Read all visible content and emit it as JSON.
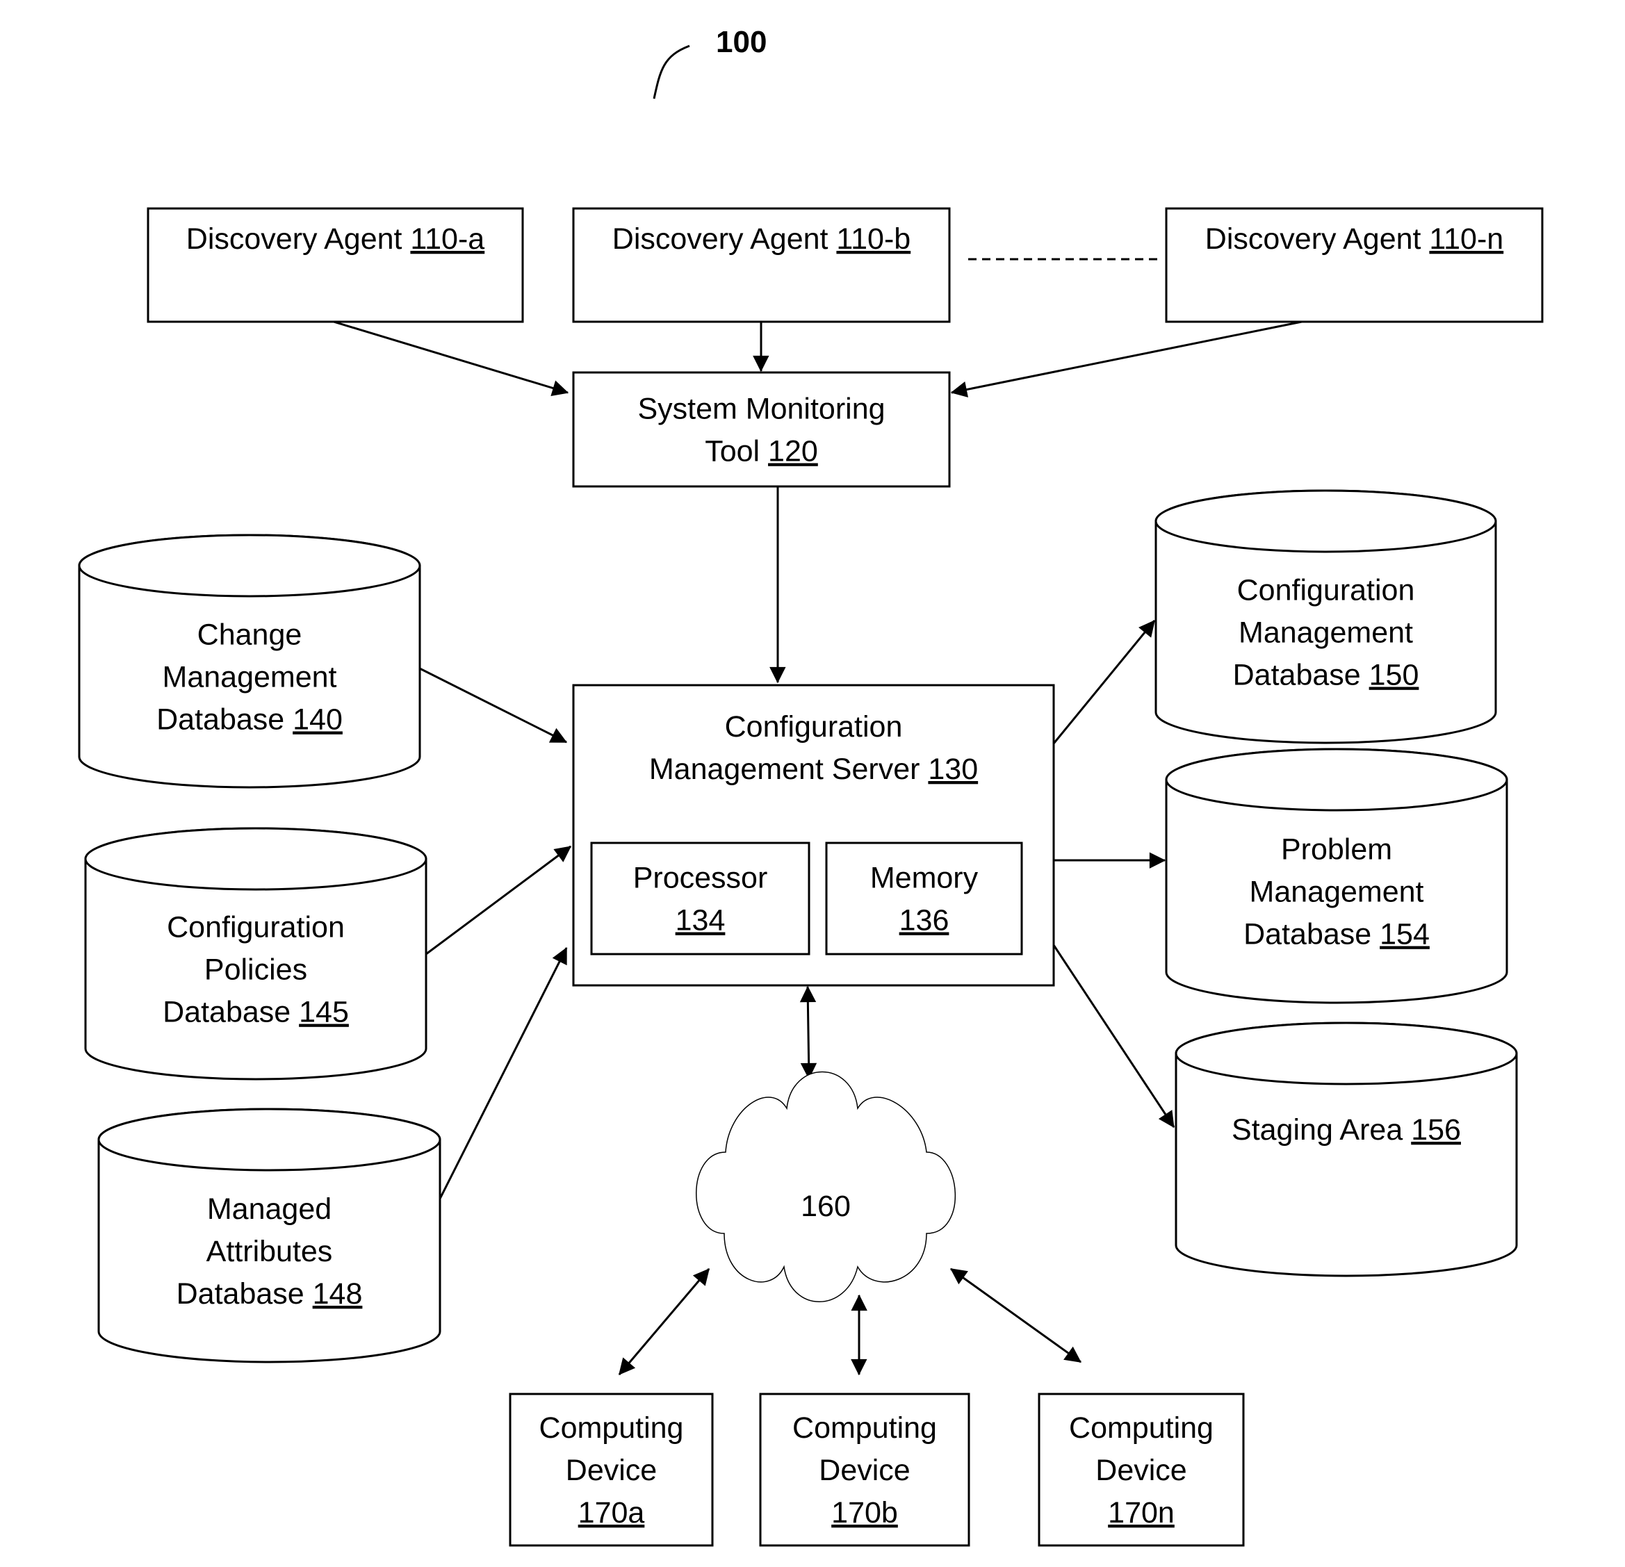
{
  "figure": {
    "reference_number": "100",
    "accent_color": "#000000",
    "background_color": "#ffffff"
  },
  "nodes": {
    "agent_a": {
      "lines": [
        {
          "text": "Discovery Agent ",
          "ref": "110-a"
        }
      ]
    },
    "agent_b": {
      "lines": [
        {
          "text": "Discovery Agent ",
          "ref": "110-b"
        }
      ]
    },
    "agent_n": {
      "lines": [
        {
          "text": "Discovery Agent ",
          "ref": "110-n"
        }
      ]
    },
    "monitoring_tool": {
      "lines": [
        {
          "text": "System Monitoring",
          "ref": ""
        },
        {
          "text": "Tool ",
          "ref": "120"
        }
      ]
    },
    "server": {
      "lines": [
        {
          "text": "Configuration",
          "ref": ""
        },
        {
          "text": "Management Server ",
          "ref": "130"
        }
      ]
    },
    "processor": {
      "lines": [
        {
          "text": "Processor",
          "ref": ""
        },
        {
          "text": "",
          "ref": "134"
        }
      ]
    },
    "memory": {
      "lines": [
        {
          "text": "Memory",
          "ref": ""
        },
        {
          "text": "",
          "ref": "136"
        }
      ]
    },
    "db_140": {
      "lines": [
        {
          "text": "Change",
          "ref": ""
        },
        {
          "text": "Management",
          "ref": ""
        },
        {
          "text": "Database ",
          "ref": "140"
        }
      ]
    },
    "db_145": {
      "lines": [
        {
          "text": "Configuration",
          "ref": ""
        },
        {
          "text": "Policies",
          "ref": ""
        },
        {
          "text": "Database ",
          "ref": "145"
        }
      ]
    },
    "db_148": {
      "lines": [
        {
          "text": "Managed",
          "ref": ""
        },
        {
          "text": "Attributes",
          "ref": ""
        },
        {
          "text": "Database ",
          "ref": "148"
        }
      ]
    },
    "db_150": {
      "lines": [
        {
          "text": "Configuration",
          "ref": ""
        },
        {
          "text": "Management",
          "ref": ""
        },
        {
          "text": "Database ",
          "ref": "150"
        }
      ]
    },
    "db_154": {
      "lines": [
        {
          "text": "Problem",
          "ref": ""
        },
        {
          "text": "Management",
          "ref": ""
        },
        {
          "text": "Database ",
          "ref": "154"
        }
      ]
    },
    "db_156": {
      "lines": [
        {
          "text": "Staging Area ",
          "ref": "156"
        }
      ]
    },
    "network": {
      "lines": [
        {
          "text": "160",
          "ref": ""
        }
      ]
    },
    "device_a": {
      "lines": [
        {
          "text": "Computing",
          "ref": ""
        },
        {
          "text": "Device",
          "ref": ""
        },
        {
          "text": "",
          "ref": "170a"
        }
      ]
    },
    "device_b": {
      "lines": [
        {
          "text": "Computing",
          "ref": ""
        },
        {
          "text": "Device",
          "ref": ""
        },
        {
          "text": "",
          "ref": "170b"
        }
      ]
    },
    "device_n": {
      "lines": [
        {
          "text": "Computing",
          "ref": ""
        },
        {
          "text": "Device",
          "ref": ""
        },
        {
          "text": "",
          "ref": "170n"
        }
      ]
    }
  },
  "edges": [
    {
      "from": "agent_a",
      "to": "monitoring_tool",
      "direction": "forward"
    },
    {
      "from": "agent_b",
      "to": "monitoring_tool",
      "direction": "forward"
    },
    {
      "from": "agent_n",
      "to": "monitoring_tool",
      "direction": "forward"
    },
    {
      "from": "agent_b",
      "to": "agent_n",
      "direction": "none",
      "style": "dashed"
    },
    {
      "from": "monitoring_tool",
      "to": "server",
      "direction": "forward"
    },
    {
      "from": "db_140",
      "to": "server",
      "direction": "forward"
    },
    {
      "from": "db_145",
      "to": "server",
      "direction": "forward"
    },
    {
      "from": "db_148",
      "to": "server",
      "direction": "forward"
    },
    {
      "from": "server",
      "to": "db_150",
      "direction": "forward"
    },
    {
      "from": "server",
      "to": "db_154",
      "direction": "forward"
    },
    {
      "from": "server",
      "to": "db_156",
      "direction": "forward"
    },
    {
      "from": "server",
      "to": "network",
      "direction": "both"
    },
    {
      "from": "network",
      "to": "device_a",
      "direction": "both"
    },
    {
      "from": "network",
      "to": "device_b",
      "direction": "both"
    },
    {
      "from": "network",
      "to": "device_n",
      "direction": "both"
    }
  ]
}
